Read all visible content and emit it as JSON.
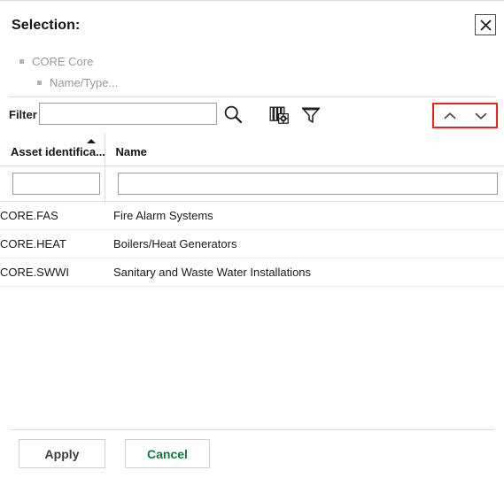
{
  "dialog": {
    "title": "Selection:",
    "close_icon": "close-icon"
  },
  "tree": {
    "items": [
      {
        "label": "CORE Core",
        "level": 0
      },
      {
        "label": "Name/Type...",
        "level": 1
      }
    ]
  },
  "toolbar": {
    "filter_label": "Filter",
    "filter_value": "",
    "filter_placeholder": "",
    "icons": [
      {
        "name": "search-icon"
      },
      {
        "name": "column-settings-icon"
      },
      {
        "name": "funnel-filter-icon"
      }
    ],
    "nav": {
      "up_icon": "chevron-up-icon",
      "down_icon": "chevron-down-icon",
      "highlight_color": "#e8251f"
    }
  },
  "table": {
    "columns": [
      {
        "header": "Asset identifica...",
        "sorted": "asc",
        "filter_value": ""
      },
      {
        "header": "Name",
        "sorted": "",
        "filter_value": ""
      }
    ],
    "rows": [
      {
        "asset": "CORE.FAS",
        "name": "Fire Alarm Systems"
      },
      {
        "asset": "CORE.HEAT",
        "name": "Boilers/Heat Generators"
      },
      {
        "asset": "CORE.SWWI",
        "name": "Sanitary and Waste Water Installations"
      }
    ]
  },
  "footer": {
    "apply_label": "Apply",
    "cancel_label": "Cancel",
    "apply_color": "#3c3c3c",
    "cancel_color": "#0b7a41"
  }
}
